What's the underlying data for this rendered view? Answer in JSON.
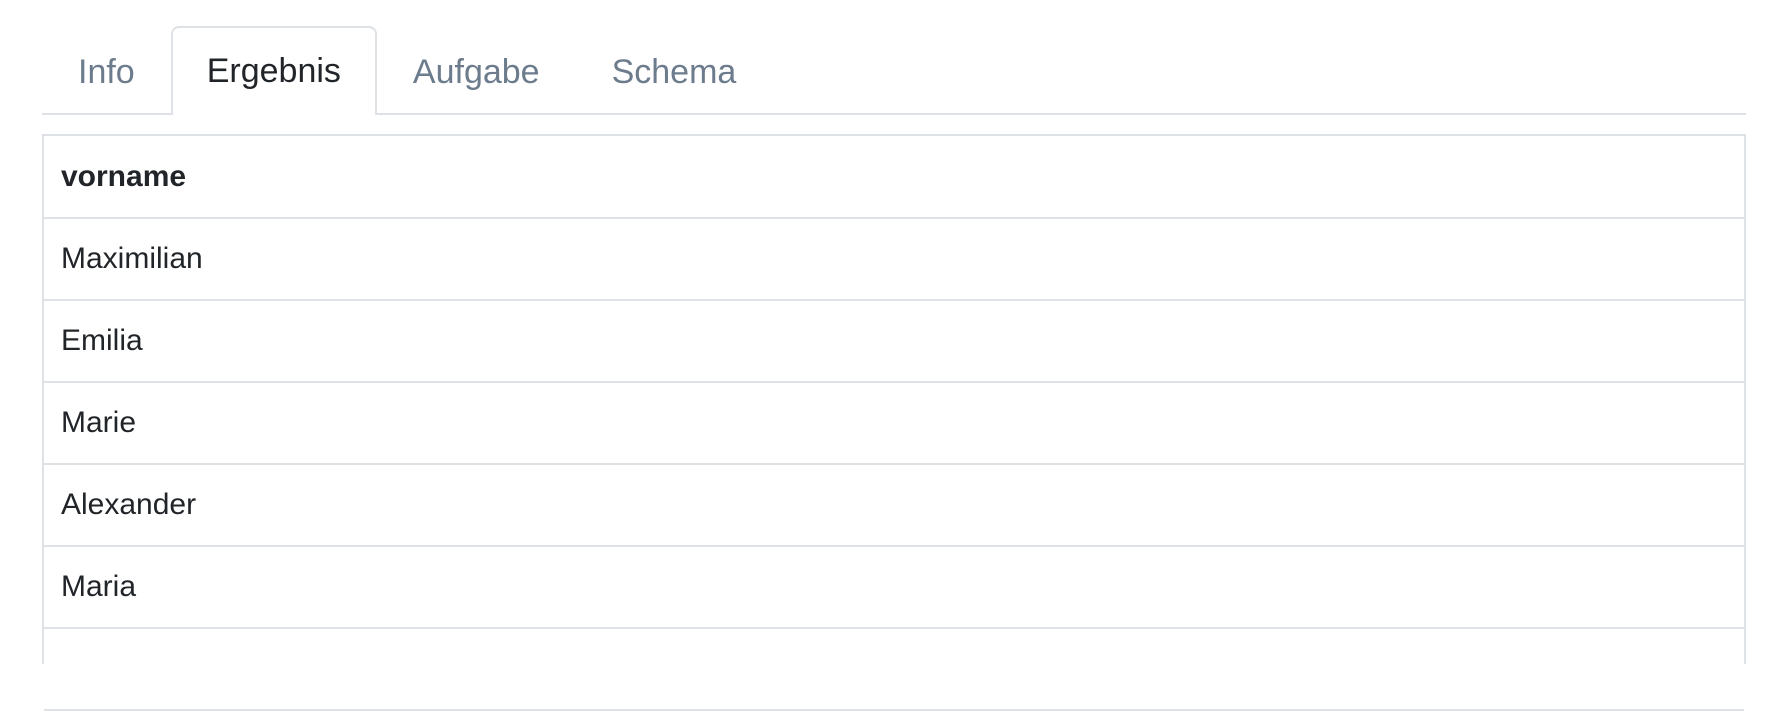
{
  "tabs": [
    {
      "label": "Info",
      "active": false
    },
    {
      "label": "Ergebnis",
      "active": true
    },
    {
      "label": "Aufgabe",
      "active": false
    },
    {
      "label": "Schema",
      "active": false
    }
  ],
  "table": {
    "columns": [
      "vorname"
    ],
    "rows": [
      [
        "Maximilian"
      ],
      [
        "Emilia"
      ],
      [
        "Marie"
      ],
      [
        "Alexander"
      ],
      [
        "Maria"
      ],
      [
        ""
      ]
    ]
  },
  "colors": {
    "active_tab_text": "#212529",
    "inactive_tab_text": "#6c7c8c",
    "border": "#dee2e6"
  }
}
